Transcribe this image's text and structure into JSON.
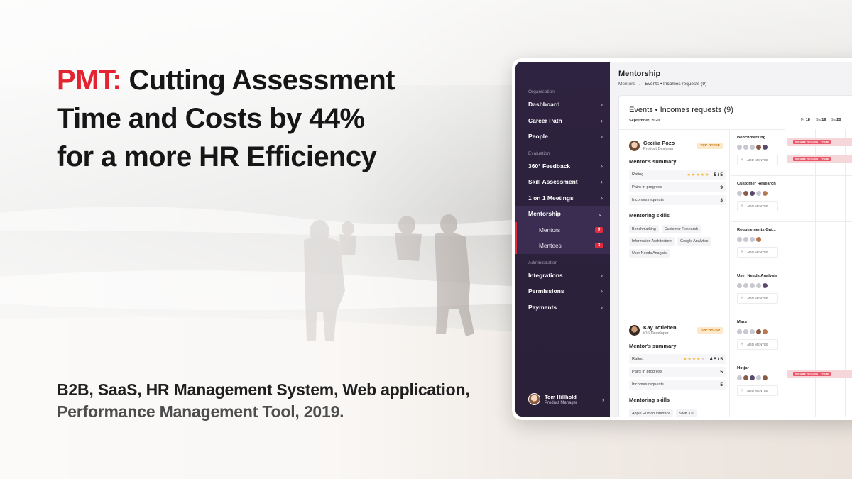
{
  "hero": {
    "accent": "PMT:",
    "title_line1": "Cutting Assessment",
    "title_line2": "Time and Costs by 44%",
    "title_line3": "for a more HR Efficiency",
    "tags_dark1": "B2B, SaaS, HR Management System, Web application,",
    "tags_line2": "Performance Management Tool, 2019."
  },
  "colors": {
    "accent": "#e32330",
    "sidebar": "#2e2340",
    "badge": "#e22a3e"
  },
  "sidebar": {
    "section_org": "Organisation",
    "dashboard": "Dashboard",
    "career_path": "Career Path",
    "people": "People",
    "section_eval": "Evaluation",
    "feedback": "360° Feedback",
    "skill_assessment": "Skill Assessment",
    "meetings": "1 on 1 Meetings",
    "mentorship": "Mentorship",
    "mentors": "Mentors",
    "mentors_count": "9",
    "mentees": "Mentees",
    "mentees_count": "3",
    "section_admin": "Administration",
    "integrations": "Integrations",
    "permissions": "Permissions",
    "payments": "Payments",
    "user_name": "Tom Hillhold",
    "user_role": "Product Manager"
  },
  "main": {
    "title": "Mentorship",
    "crumb_root": "Mentors",
    "crumb_sep": "/",
    "crumb_current": "Events • Incomes requests (9)",
    "card_title": "Events  •  Incomes requests (9)",
    "date": "September, 2020",
    "days": [
      {
        "d": "Fr",
        "n": "18"
      },
      {
        "d": "Sa",
        "n": "19"
      },
      {
        "d": "Sa",
        "n": "20"
      }
    ]
  },
  "mentors": [
    {
      "name": "Cecilia Pozo",
      "role": "Product Designer",
      "badge": "TOP-RATED",
      "summary_title": "Mentor's summary",
      "rating_label": "Rating",
      "rating": "5 / 5",
      "rating_value": 5,
      "pairs_label": "Pairs in progress",
      "pairs": "9",
      "incomes_label": "Incomes requests",
      "incomes": "3",
      "skills_title": "Mentoring skills",
      "skills": [
        "Benchmarking",
        "Customer Research",
        "Information Architecture",
        "Google Analytics",
        "User Needs Analysis"
      ]
    },
    {
      "name": "Kay Totleben",
      "role": "iOS Developer",
      "badge": "TOP-RATED",
      "summary_title": "Mentor's summary",
      "rating_label": "Rating",
      "rating": "4.5 / 5",
      "rating_value": 4.5,
      "pairs_label": "Pairs in progress",
      "pairs": "5",
      "incomes_label": "Incomes requests",
      "incomes": "5",
      "skills_title": "Mentoring skills",
      "skills": [
        "Apple Human Interface",
        "Swift 3.0"
      ]
    }
  ],
  "projects": [
    {
      "title": "Benchmarking",
      "add": "ADD MENTEE"
    },
    {
      "title": "Customer Research",
      "add": "ADD MENTEE"
    },
    {
      "title": "Requirements Gat...",
      "add": "ADD MENTEE"
    },
    {
      "title": "User Needs Analysis",
      "add": "ADD MENTEE"
    },
    {
      "title": "Maze",
      "add": "ADD MENTEE"
    },
    {
      "title": "Hotjar",
      "add": "ADD MENTEE"
    }
  ],
  "requests": [
    "INCOME REQUEST FROM",
    "INCOME REQUEST FROM",
    "INCOME REQUEST FROM"
  ]
}
